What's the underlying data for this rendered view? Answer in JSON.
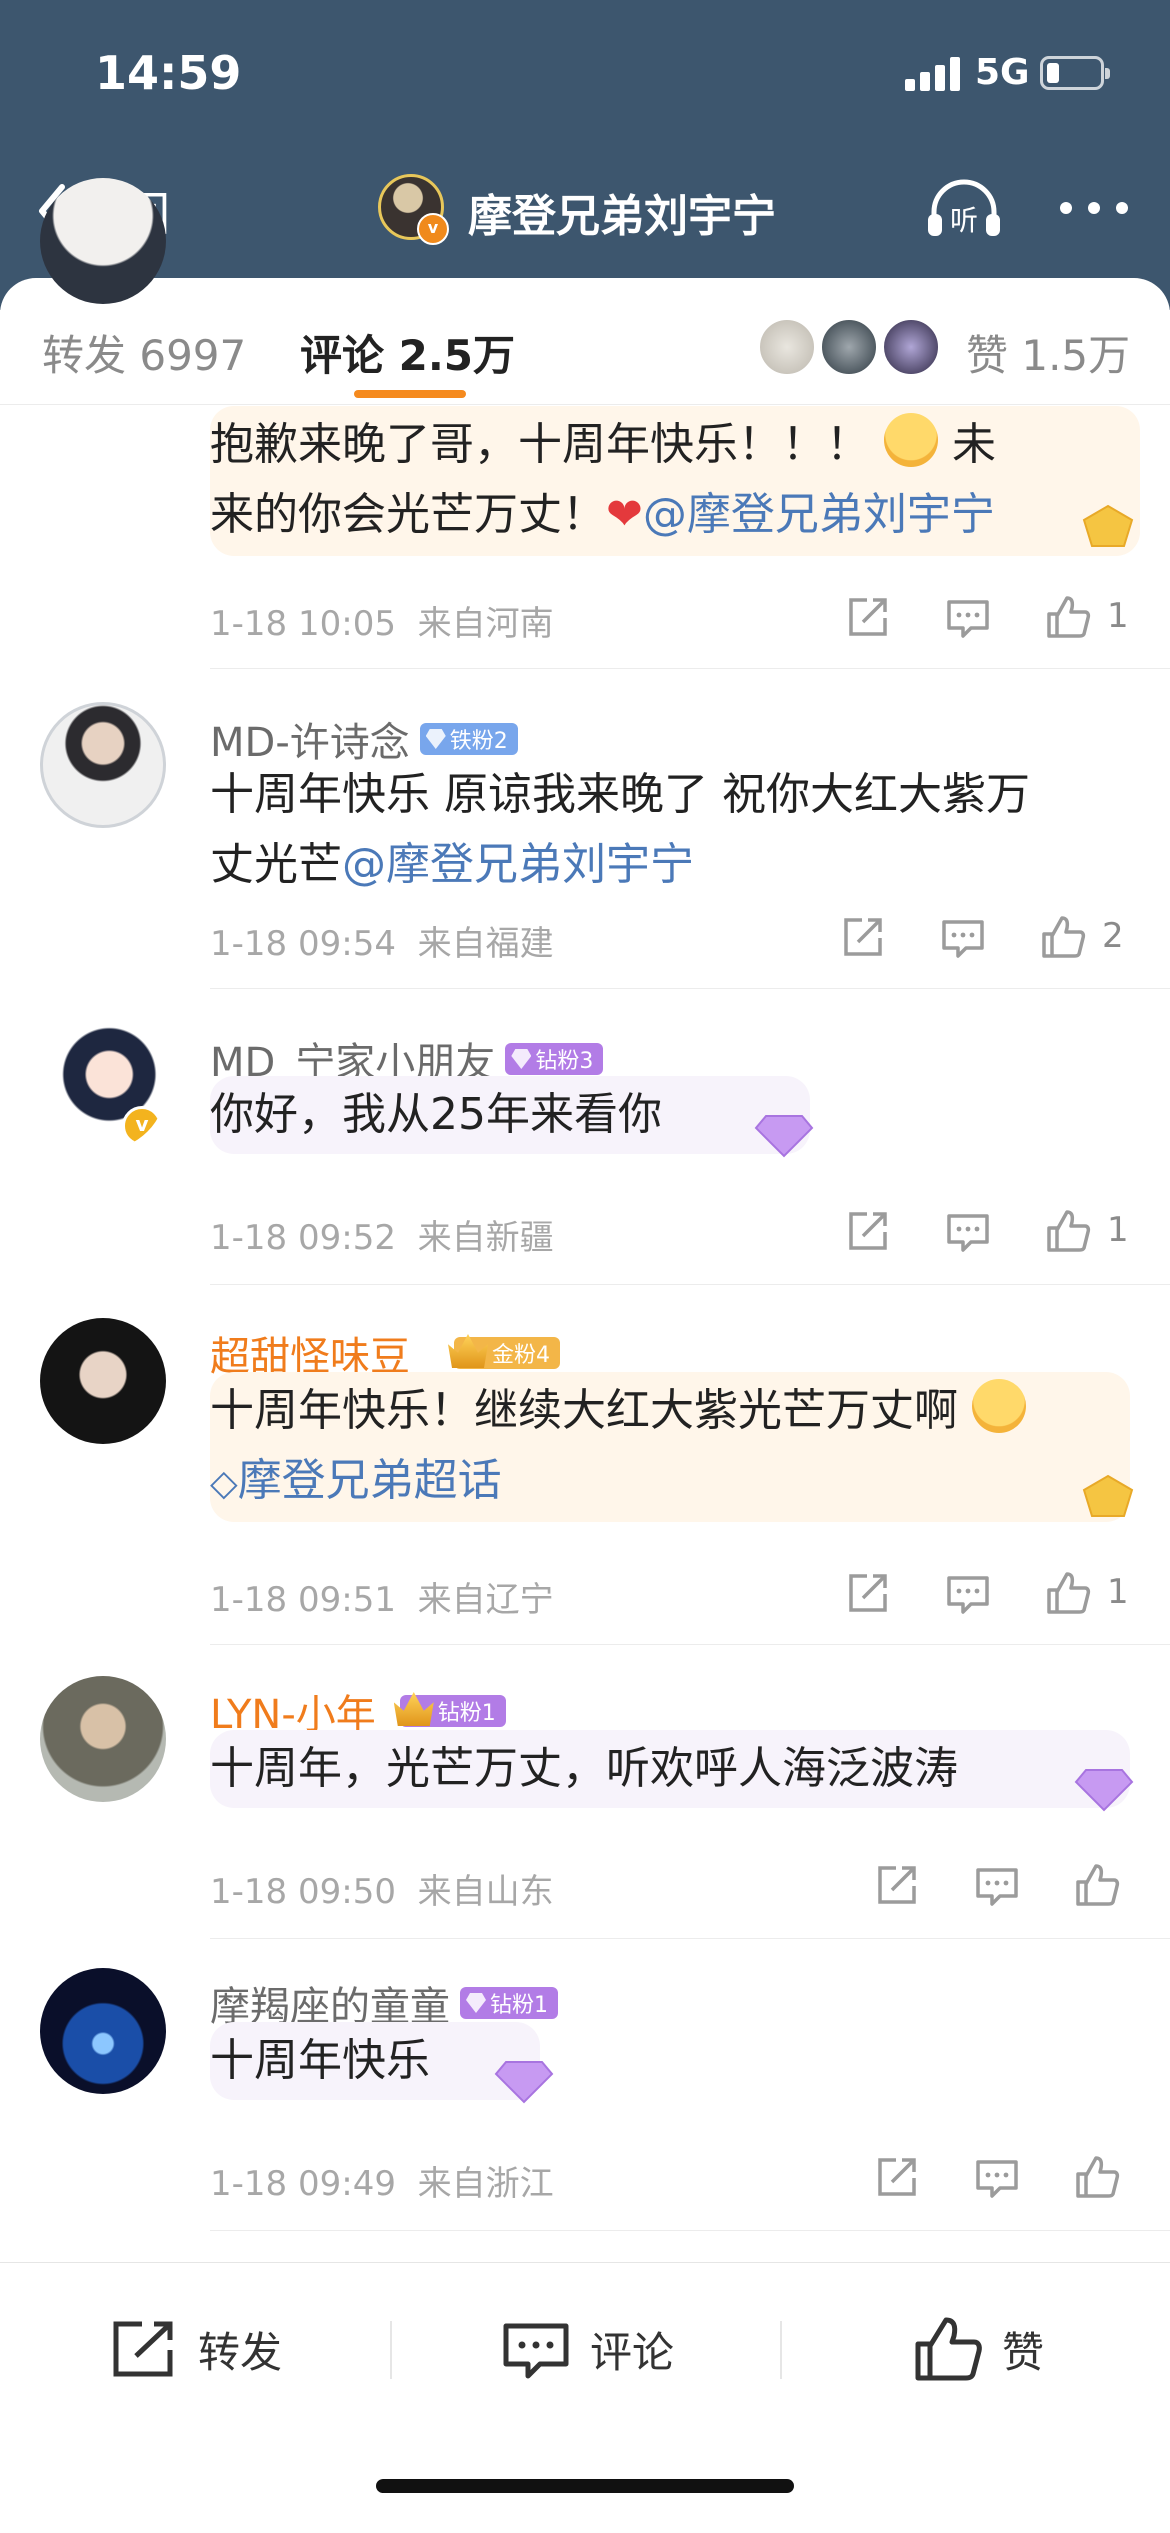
{
  "status": {
    "time": "14:59",
    "network": "5G"
  },
  "nav": {
    "back_label": "返回",
    "title": "摩登兄弟刘宇宁",
    "listen_label": "听"
  },
  "tabs": {
    "repost": "转发 6997",
    "comments": "评论 2.5万",
    "likes": "赞 1.5万"
  },
  "comments": [
    {
      "text_a": "抱歉来晚了哥，十周年快乐！！！",
      "text_b": "未",
      "text_c": "来的你会光芒万丈！",
      "mention": "@摩登兄弟刘宇宁",
      "time": "1-18 10:05",
      "location": "来自河南",
      "likes": "1"
    },
    {
      "user": "MD-许诗念",
      "badge": "铁粉2",
      "text_a": "十周年快乐 原谅我来晚了 祝你大红大紫万",
      "text_b": "丈光芒",
      "mention": "@摩登兄弟刘宇宁",
      "time": "1-18 09:54",
      "location": "来自福建",
      "likes": "2"
    },
    {
      "user": "MD_宁家小朋友",
      "badge": "钻粉3",
      "text_a": "你好，我从25年来看你",
      "time": "1-18 09:52",
      "location": "来自新疆",
      "likes": "1"
    },
    {
      "user": "超甜怪味豆_",
      "badge": "金粉4",
      "text_a": "十周年快乐！继续大红大紫光芒万丈啊",
      "topic": "摩登兄弟超话",
      "time": "1-18 09:51",
      "location": "来自辽宁",
      "likes": "1"
    },
    {
      "user": "LYN-小年",
      "badge": "钻粉1",
      "text_a": "十周年，光芒万丈，听欢呼人海泛波涛",
      "time": "1-18 09:50",
      "location": "来自山东"
    },
    {
      "user": "摩羯座的童童",
      "badge": "钻粉1",
      "text_a": "十周年快乐",
      "time": "1-18 09:49",
      "location": "来自浙江"
    }
  ],
  "bottom": {
    "repost": "转发",
    "comment": "评论",
    "like": "赞"
  },
  "colors": {
    "header_bg": "#3d566e",
    "accent": "#f58a1e",
    "mention": "#4b79b8"
  },
  "icons": [
    "back-chevron-icon",
    "listen-headphone-icon",
    "more-dots-icon",
    "share-icon",
    "comment-icon",
    "thumbs-up-icon"
  ]
}
